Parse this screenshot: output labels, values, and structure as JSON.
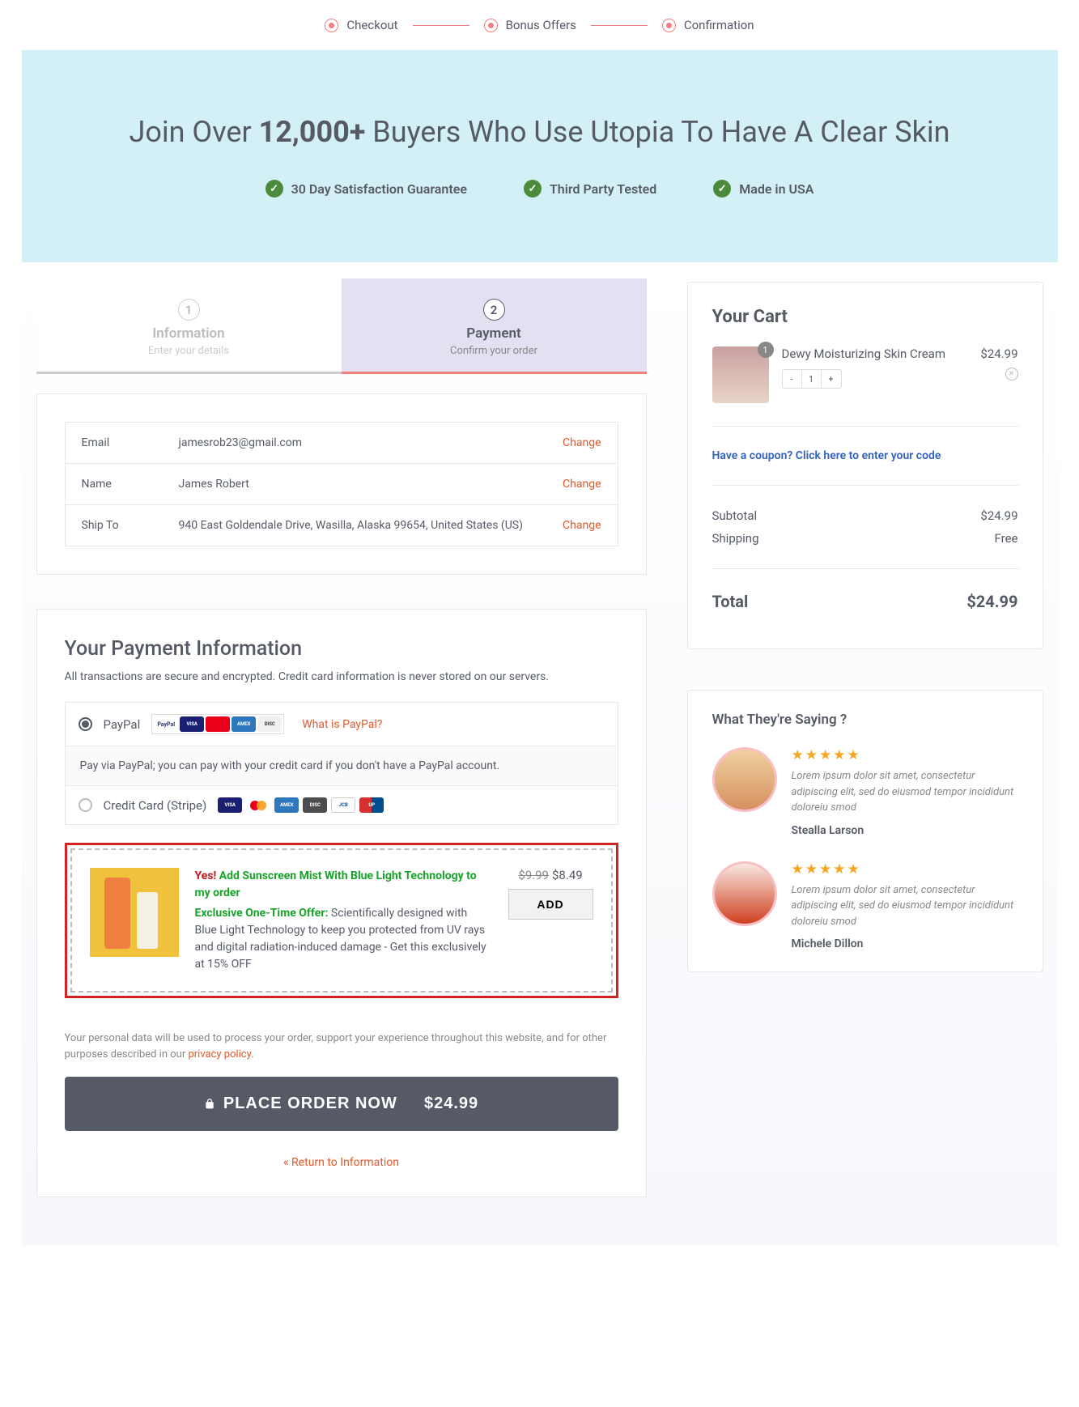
{
  "stepper": {
    "steps": [
      "Checkout",
      "Bonus Offers",
      "Confirmation"
    ]
  },
  "hero": {
    "title_prefix": "Join Over ",
    "title_strong": "12,000+",
    "title_suffix": " Buyers Who Use Utopia To Have A Clear Skin",
    "badges": [
      "30 Day Satisfaction Guarantee",
      "Third Party Tested",
      "Made in USA"
    ]
  },
  "tabs": {
    "info": {
      "num": "1",
      "title": "Information",
      "sub": "Enter your details"
    },
    "pay": {
      "num": "2",
      "title": "Payment",
      "sub": "Confirm your order"
    }
  },
  "summary": {
    "email_label": "Email",
    "email_value": "jamesrob23@gmail.com",
    "name_label": "Name",
    "name_value": "James Robert",
    "ship_label": "Ship To",
    "ship_value": "940 East Goldendale Drive, Wasilla, Alaska 99654, United States (US)",
    "change": "Change"
  },
  "payment": {
    "heading": "Your Payment Information",
    "note": "All transactions are secure and encrypted. Credit card information is never stored on our servers.",
    "paypal_label": "PayPal",
    "paypal_help": "What is PayPal?",
    "paypal_desc": "Pay via PayPal; you can pay with your credit card if you don't have a PayPal account.",
    "stripe_label": "Credit Card (Stripe)"
  },
  "bump": {
    "yes": "Yes!",
    "title": "Add Sunscreen Mist With Blue Light Technology to my order",
    "offer_label": "Exclusive One-Time Offer:",
    "offer_text": " Scientifically designed with Blue Light Technology to keep you protected from UV rays and digital radiation-induced damage - Get this exclusively at 15% OFF",
    "old_price": "$9.99",
    "new_price": "$8.49",
    "add": "ADD"
  },
  "privacy": {
    "text": "Your personal data will be used to process your order, support your experience throughout this website, and for other purposes described in our ",
    "link": "privacy policy"
  },
  "place": {
    "label": "PLACE ORDER NOW",
    "total": "$24.99"
  },
  "return_link": "« Return to Information",
  "cart": {
    "heading": "Your Cart",
    "item": {
      "qty": "1",
      "name": "Dewy Moisturizing Skin Cream",
      "price": "$24.99",
      "minus": "-",
      "count": "1",
      "plus": "+"
    },
    "coupon": "Have a coupon? Click here to enter your code",
    "subtotal_label": "Subtotal",
    "subtotal_value": "$24.99",
    "shipping_label": "Shipping",
    "shipping_value": "Free",
    "total_label": "Total",
    "total_value": "$24.99"
  },
  "testimonials": {
    "heading": "What They're Saying ?",
    "items": [
      {
        "text": "Lorem ipsum dolor sit amet, consectetur adipiscing elit, sed do eiusmod tempor incididunt doloreiu smod",
        "name": "Stealla Larson"
      },
      {
        "text": "Lorem ipsum dolor sit amet, consectetur adipiscing elit, sed do eiusmod tempor incididunt doloreiu smod",
        "name": "Michele Dillon"
      }
    ]
  }
}
